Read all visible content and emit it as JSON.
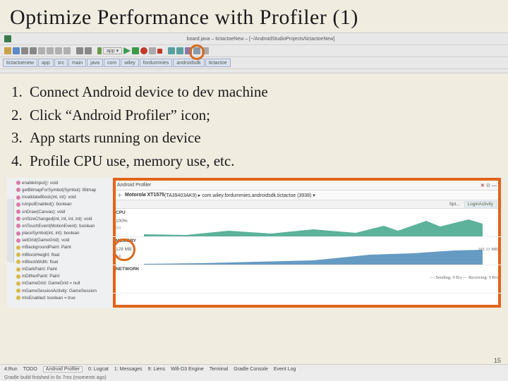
{
  "title": "Optimize Performance with Profiler (1)",
  "steps": [
    "Connect Android device to dev machine",
    "Click “Android Profiler” icon;",
    "App starts running on device",
    "Profile CPU use, memory use, etc."
  ],
  "ide": {
    "breadcrumb": [
      "tictactoenew",
      "app",
      "src",
      "main",
      "java",
      "com",
      "wiley",
      "fordummies",
      "androidsdk",
      "tictactoe"
    ]
  },
  "left_panel": {
    "items": [
      {
        "c": "pink",
        "t": "enableInput(): void"
      },
      {
        "c": "pink",
        "t": "getBitmapForSymbol(Symbol): Bitmap"
      },
      {
        "c": "pink",
        "t": "invalidateBlock(int, int): void"
      },
      {
        "c": "pink",
        "t": "isInputEnabled(): boolean"
      },
      {
        "c": "pink",
        "t": "onDraw(Canvas): void"
      },
      {
        "c": "pink",
        "t": "onSizeChanged(int, int, int, int): void"
      },
      {
        "c": "pink",
        "t": "onTouchEvent(MotionEvent): boolean"
      },
      {
        "c": "pink",
        "t": "placeSymbol(int, int): boolean"
      },
      {
        "c": "pink",
        "t": "setGrid(GameGrid): void"
      },
      {
        "c": "yellow",
        "t": "mBackgroundPaint: Paint"
      },
      {
        "c": "yellow",
        "t": "mBlockHeight: float"
      },
      {
        "c": "yellow",
        "t": "mBlockWidth: float"
      },
      {
        "c": "yellow",
        "t": "mDarkPaint: Paint"
      },
      {
        "c": "yellow",
        "t": "mDitherPaint: Paint"
      },
      {
        "c": "yellow",
        "t": "mGameGrid: GameGrid = null"
      },
      {
        "c": "yellow",
        "t": "mGameSessionActivity: GameSession"
      },
      {
        "c": "yellow",
        "t": "mIsEnabled: boolean = true"
      }
    ]
  },
  "profiler": {
    "header_title": "Android Profiler",
    "device_line_strong": "Motorola XT1575",
    "device_line_rest": " (TA39403AK9) ▸ com.wiley.fordummies.androidsdk.tictactoe (3938) ▾",
    "topbar_right": [
      "Spl...",
      "LoginActivity"
    ],
    "cpu": {
      "label": "CPU",
      "val1": "100%",
      "val2": "50"
    },
    "mem": {
      "label": "MEMORY",
      "val1": "128 MB",
      "val2": "64",
      "right": "101.11 MB"
    },
    "net": {
      "label": "NETWORK",
      "right": "— Sending: 0 B/s  — Receiving: 0 B/s"
    }
  },
  "footer": {
    "tabs": [
      "4:Run",
      "TODO",
      "Android Profiler",
      "0: Logcat",
      "1: Messages",
      "9: Liens",
      "Wifi-D3 Engine",
      "Terminal",
      "Gradle Console",
      "Event Log"
    ],
    "status": "Gradle build finished in 6s 7ms (moments ago)"
  },
  "page_number": "15",
  "colors": {
    "accent_orange": "#e2641a"
  }
}
